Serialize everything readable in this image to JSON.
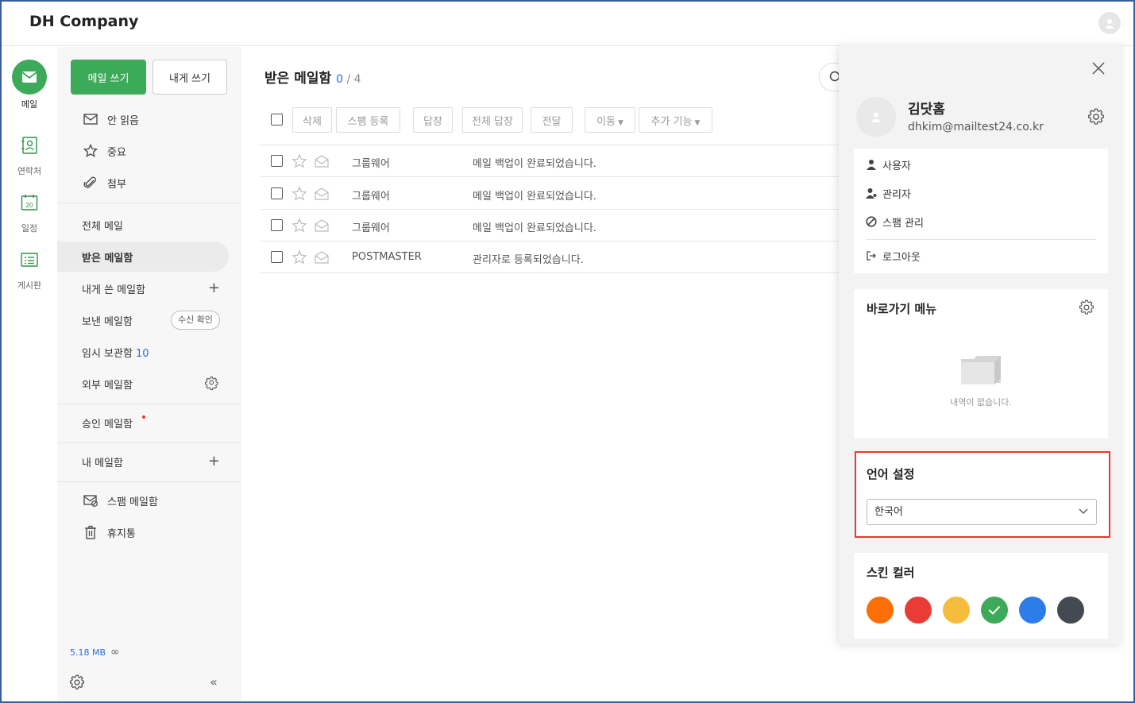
{
  "header": {
    "brand": "DH Company"
  },
  "rail": [
    {
      "label": "메일",
      "icon": "mail-icon",
      "active": true
    },
    {
      "label": "연락처",
      "icon": "contacts-icon"
    },
    {
      "label": "일정",
      "icon": "calendar-icon",
      "badge": "20"
    },
    {
      "label": "게시판",
      "icon": "board-icon"
    }
  ],
  "sidebar": {
    "write_label": "메일 쓰기",
    "self_write_label": "내게 쓰기",
    "quick": [
      {
        "label": "안 읽음",
        "icon": "envelope-icon"
      },
      {
        "label": "중요",
        "icon": "star-icon"
      },
      {
        "label": "첨부",
        "icon": "paperclip-icon"
      }
    ],
    "all_mail": "전체 메일",
    "inbox": "받은 메일함",
    "self_box": "내게 쓴 메일함",
    "sent": "보낸 메일함",
    "read_receipt": "수신 확인",
    "drafts": "임시 보관함",
    "drafts_count": "10",
    "external": "외부 메일함",
    "approval": "승인 메일함",
    "my_mail": "내 메일함",
    "spam": "스팸 메일함",
    "trash": "휴지통",
    "storage": "5.18 MB",
    "storage_limit": "∞",
    "collapse": "«"
  },
  "main": {
    "title": "받은 메일함",
    "unread": "0",
    "total": "/ 4",
    "toolbar": {
      "delete": "삭제",
      "spam": "스팸 등록",
      "reply": "답장",
      "reply_all": "전체 답장",
      "forward": "전달",
      "move": "이동",
      "more": "추가 기능"
    },
    "rows": [
      {
        "from": "그룹웨어",
        "subject": "메일 백업이 완료되었습니다."
      },
      {
        "from": "그룹웨어",
        "subject": "메일 백업이 완료되었습니다."
      },
      {
        "from": "그룹웨어",
        "subject": "메일 백업이 완료되었습니다."
      },
      {
        "from": "POSTMASTER",
        "subject": "관리자로 등록되었습니다."
      }
    ]
  },
  "panel": {
    "name": "김닷홈",
    "email": "dhkim@mailtest24.co.kr",
    "menu": {
      "user": "사용자",
      "admin": "관리자",
      "spam_mgmt": "스팸 관리",
      "logout": "로그아웃"
    },
    "shortcut_title": "바로가기 메뉴",
    "shortcut_empty": "내역이 없습니다.",
    "language_title": "언어 설정",
    "language_value": "한국어",
    "skin_title": "스킨 컬러",
    "skins": [
      "#fb6f06",
      "#e93c36",
      "#f6bd3c",
      "#3daa59",
      "#2d7de9",
      "#444a52"
    ],
    "selected_skin": "#3daa59"
  }
}
